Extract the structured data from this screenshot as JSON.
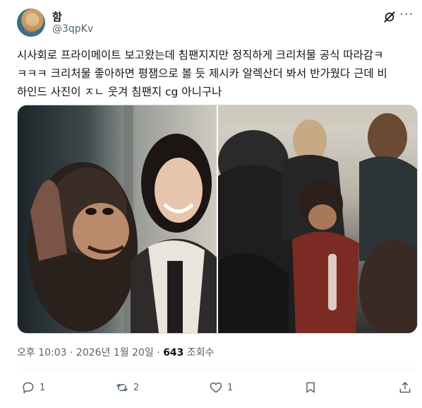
{
  "author": {
    "display_name": "함",
    "handle": "@3qpKv"
  },
  "icons": {
    "grok": "grok-icon",
    "more": "more-icon",
    "reply": "reply-icon",
    "repost": "repost-icon",
    "like": "heart-icon",
    "bookmark": "bookmark-icon",
    "share": "share-icon"
  },
  "tweet": {
    "text_lines": [
      "시사회로 프라이메이트 보고왔는데 침팬지지만 정직하게 크리처물 공식 따라감ㅋ",
      "ㅋㅋㅋ 크리처물 좋아하면 평잼으로 볼 듯 제시카 알렉산더 봐서 반가웠다 근데 비",
      "하인드  사진이 ㅈㄴ 웃겨 침팬지 cg 아니구나"
    ]
  },
  "media": {
    "images": [
      {
        "alt": "chimpanzee-and-actress-photo"
      },
      {
        "alt": "chimpanzee-makeup-crew-photo"
      }
    ]
  },
  "meta": {
    "time": "오후 10:03",
    "separator": "·",
    "date": "2026년 1월 20일",
    "views_count": "643",
    "views_label": "조회수"
  },
  "actions": {
    "replies": "1",
    "reposts": "2",
    "likes": "1"
  },
  "colors": {
    "text_primary": "#0f1419",
    "text_secondary": "#536471",
    "border": "#cfd9de"
  }
}
